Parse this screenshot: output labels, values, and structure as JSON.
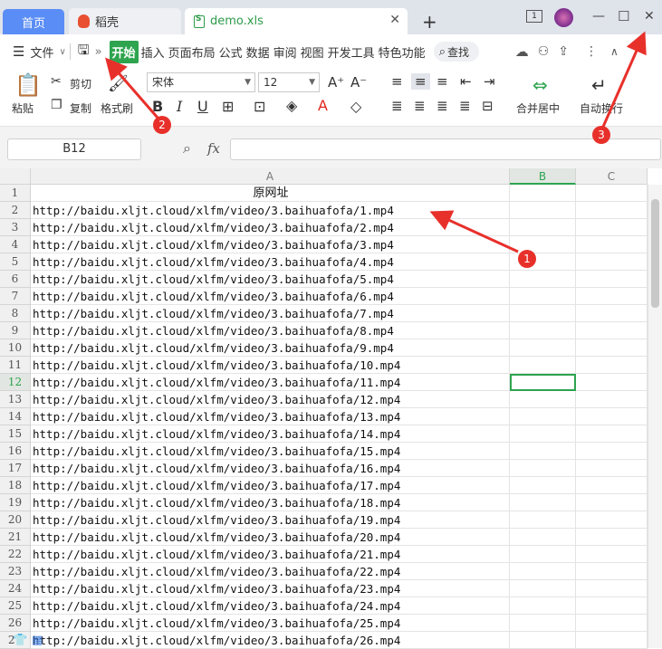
{
  "tabs": {
    "home": "首页",
    "daoke": "稻壳",
    "file": "demo.xls",
    "badge": "1"
  },
  "ribbon_tabs": [
    "开始",
    "插入",
    "页面布局",
    "公式",
    "数据",
    "审阅",
    "视图",
    "开发工具",
    "特色功能"
  ],
  "ribbon_tab_active": 0,
  "menu": {
    "file": "文件",
    "search": "查找"
  },
  "ribbon": {
    "paste": "粘贴",
    "cut": "剪切",
    "copy": "复制",
    "format_painter": "格式刷",
    "font_name": "宋体",
    "font_size": "12",
    "merge_center": "合并居中",
    "wrap": "自动换行"
  },
  "formula_bar": {
    "name_box": "B12",
    "fx": "fx",
    "formula": ""
  },
  "columns": [
    "A",
    "B",
    "C"
  ],
  "rows": [
    {
      "num": "1",
      "a": "原网址"
    },
    {
      "num": "2",
      "a": "http://baidu.xljt.cloud/xlfm/video/3.baihuafofa/1.mp4"
    },
    {
      "num": "3",
      "a": "http://baidu.xljt.cloud/xlfm/video/3.baihuafofa/2.mp4"
    },
    {
      "num": "4",
      "a": "http://baidu.xljt.cloud/xlfm/video/3.baihuafofa/3.mp4"
    },
    {
      "num": "5",
      "a": "http://baidu.xljt.cloud/xlfm/video/3.baihuafofa/4.mp4"
    },
    {
      "num": "6",
      "a": "http://baidu.xljt.cloud/xlfm/video/3.baihuafofa/5.mp4"
    },
    {
      "num": "7",
      "a": "http://baidu.xljt.cloud/xlfm/video/3.baihuafofa/6.mp4"
    },
    {
      "num": "8",
      "a": "http://baidu.xljt.cloud/xlfm/video/3.baihuafofa/7.mp4"
    },
    {
      "num": "9",
      "a": "http://baidu.xljt.cloud/xlfm/video/3.baihuafofa/8.mp4"
    },
    {
      "num": "10",
      "a": "http://baidu.xljt.cloud/xlfm/video/3.baihuafofa/9.mp4"
    },
    {
      "num": "11",
      "a": "http://baidu.xljt.cloud/xlfm/video/3.baihuafofa/10.mp4"
    },
    {
      "num": "12",
      "a": "http://baidu.xljt.cloud/xlfm/video/3.baihuafofa/11.mp4"
    },
    {
      "num": "13",
      "a": "http://baidu.xljt.cloud/xlfm/video/3.baihuafofa/12.mp4"
    },
    {
      "num": "14",
      "a": "http://baidu.xljt.cloud/xlfm/video/3.baihuafofa/13.mp4"
    },
    {
      "num": "15",
      "a": "http://baidu.xljt.cloud/xlfm/video/3.baihuafofa/14.mp4"
    },
    {
      "num": "16",
      "a": "http://baidu.xljt.cloud/xlfm/video/3.baihuafofa/15.mp4"
    },
    {
      "num": "17",
      "a": "http://baidu.xljt.cloud/xlfm/video/3.baihuafofa/16.mp4"
    },
    {
      "num": "18",
      "a": "http://baidu.xljt.cloud/xlfm/video/3.baihuafofa/17.mp4"
    },
    {
      "num": "19",
      "a": "http://baidu.xljt.cloud/xlfm/video/3.baihuafofa/18.mp4"
    },
    {
      "num": "20",
      "a": "http://baidu.xljt.cloud/xlfm/video/3.baihuafofa/19.mp4"
    },
    {
      "num": "21",
      "a": "http://baidu.xljt.cloud/xlfm/video/3.baihuafofa/20.mp4"
    },
    {
      "num": "22",
      "a": "http://baidu.xljt.cloud/xlfm/video/3.baihuafofa/21.mp4"
    },
    {
      "num": "23",
      "a": "http://baidu.xljt.cloud/xlfm/video/3.baihuafofa/22.mp4"
    },
    {
      "num": "24",
      "a": "http://baidu.xljt.cloud/xlfm/video/3.baihuafofa/23.mp4"
    },
    {
      "num": "25",
      "a": "http://baidu.xljt.cloud/xlfm/video/3.baihuafofa/24.mp4"
    },
    {
      "num": "26",
      "a": "http://baidu.xljt.cloud/xlfm/video/3.baihuafofa/25.mp4"
    },
    {
      "num": "27",
      "a": "http://baidu.xljt.cloud/xlfm/video/3.baihuafofa/26.mp4"
    }
  ],
  "selected_row": 12,
  "annotations": [
    "1",
    "2",
    "3"
  ],
  "colors": {
    "accent_green": "#2ea44f",
    "home_tab": "#5a8df5",
    "annotation_red": "#e8302b"
  }
}
